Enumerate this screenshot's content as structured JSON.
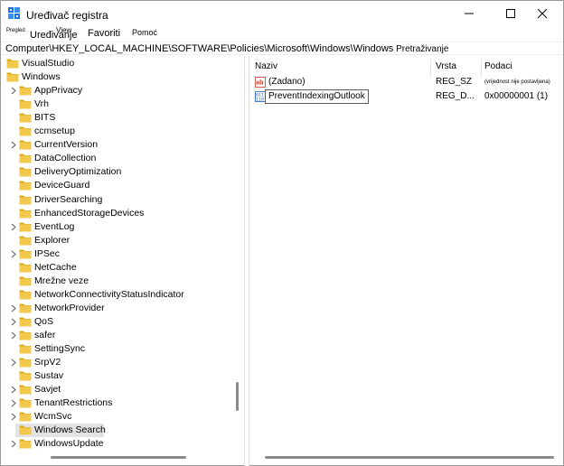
{
  "window": {
    "title": "Uređivač registra"
  },
  "menu": {
    "file": "Pregled",
    "edit": "Uređivanje",
    "view": "View",
    "favorites": "Favoriti",
    "help": "Pomoć"
  },
  "address": {
    "path": "Computer\\HKEY_LOCAL_MACHINE\\SOFTWARE\\Policies\\Microsoft\\Windows\\Windows",
    "tail": " Pretraživanje"
  },
  "tree": {
    "items": [
      {
        "label": "VisualStudio",
        "level": 0,
        "expandable": false
      },
      {
        "label": "Windows",
        "level": 0,
        "expandable": false,
        "expanded": true
      },
      {
        "label": "AppPrivacy",
        "level": 1,
        "expandable": true
      },
      {
        "label": "Vrh",
        "level": 1,
        "expandable": false
      },
      {
        "label": "BITS",
        "level": 1,
        "expandable": false
      },
      {
        "label": "ccmsetup",
        "level": 1,
        "expandable": false
      },
      {
        "label": "CurrentVersion",
        "level": 1,
        "expandable": true
      },
      {
        "label": "DataCollection",
        "level": 1,
        "expandable": false
      },
      {
        "label": "DeliveryOptimization",
        "level": 1,
        "expandable": false
      },
      {
        "label": "DeviceGuard",
        "level": 1,
        "expandable": false
      },
      {
        "label": "DriverSearching",
        "level": 1,
        "expandable": false
      },
      {
        "label": "EnhancedStorageDevices",
        "level": 1,
        "expandable": false
      },
      {
        "label": "EventLog",
        "level": 1,
        "expandable": true
      },
      {
        "label": "Explorer",
        "level": 1,
        "expandable": false
      },
      {
        "label": "IPSec",
        "level": 1,
        "expandable": true
      },
      {
        "label": "NetCache",
        "level": 1,
        "expandable": false
      },
      {
        "label": "Mrežne veze",
        "level": 1,
        "expandable": false
      },
      {
        "label": "NetworkConnectivityStatusIndicator",
        "level": 1,
        "expandable": false
      },
      {
        "label": "NetworkProvider",
        "level": 1,
        "expandable": true
      },
      {
        "label": "QoS",
        "level": 1,
        "expandable": true
      },
      {
        "label": "safer",
        "level": 1,
        "expandable": true
      },
      {
        "label": "SettingSync",
        "level": 1,
        "expandable": false
      },
      {
        "label": "SrpV2",
        "level": 1,
        "expandable": true
      },
      {
        "label": "Sustav",
        "level": 1,
        "expandable": false
      },
      {
        "label": "Savjet",
        "level": 1,
        "expandable": true
      },
      {
        "label": "TenantRestrictions",
        "level": 1,
        "expandable": true
      },
      {
        "label": "WcmSvc",
        "level": 1,
        "expandable": true
      },
      {
        "label": "Windows Search",
        "level": 1,
        "expandable": false,
        "selected": true
      },
      {
        "label": "WindowsUpdate",
        "level": 1,
        "expandable": true
      }
    ]
  },
  "list": {
    "columns": {
      "name": "Naziv",
      "type": "Vrsta",
      "data": "Podaci"
    },
    "rows": [
      {
        "icon": "string-value-icon",
        "name": "(Zadano)",
        "type": "REG_SZ",
        "data": "(vrijednost nije postavljena)"
      },
      {
        "icon": "dword-value-icon",
        "name": "PreventIndexingOutlook",
        "type": "REG_D...",
        "data": "0x00000001 (1)",
        "editing": true
      }
    ]
  },
  "colors": {
    "folder": "#f2c94c",
    "folder_dark": "#dca91b",
    "selection": "#e3e3e3"
  }
}
